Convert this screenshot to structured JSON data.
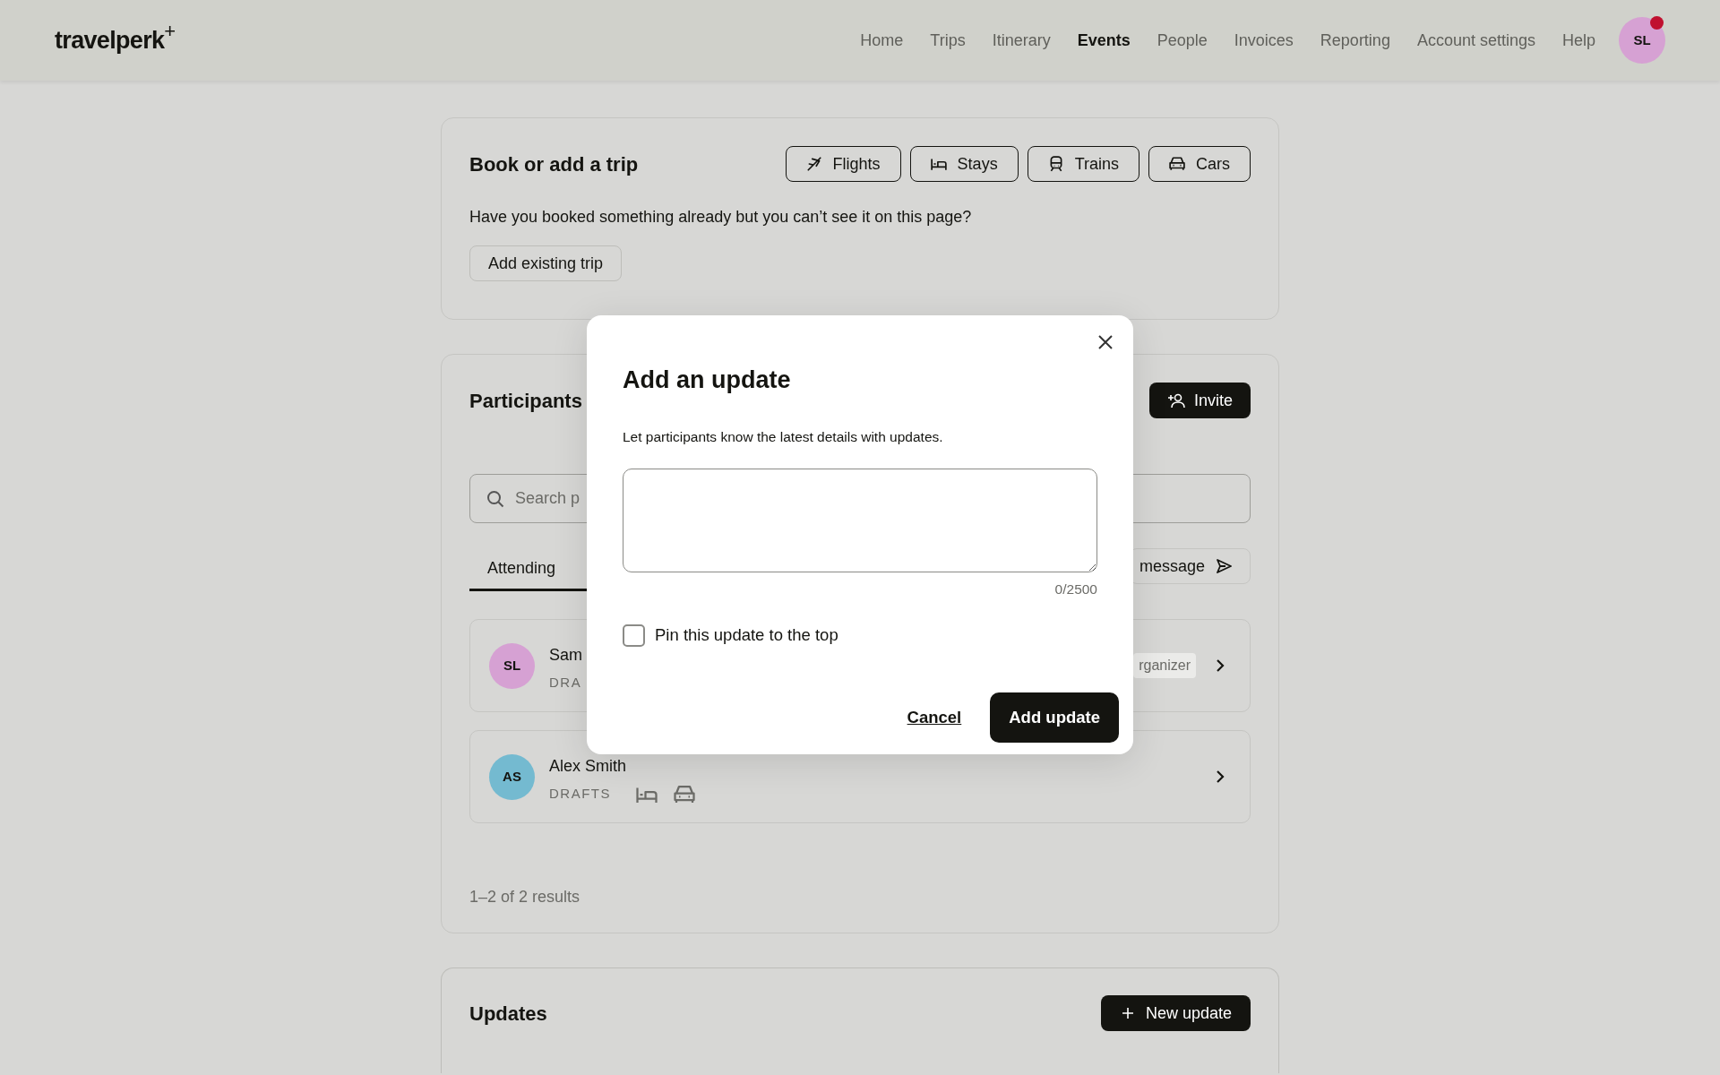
{
  "header": {
    "logo": "travelperk",
    "logo_mark": "+",
    "nav": [
      {
        "label": "Home",
        "selected": false
      },
      {
        "label": "Trips",
        "selected": false
      },
      {
        "label": "Itinerary",
        "selected": false
      },
      {
        "label": "Events",
        "selected": true
      },
      {
        "label": "People",
        "selected": false
      },
      {
        "label": "Invoices",
        "selected": false
      },
      {
        "label": "Reporting",
        "selected": false
      },
      {
        "label": "Account settings",
        "selected": false
      },
      {
        "label": "Help",
        "selected": false
      }
    ],
    "avatar": {
      "initials": "SL",
      "color": "#d6a1d3",
      "notification": true
    }
  },
  "book_trip": {
    "title": "Book or add a trip",
    "buttons": [
      {
        "label": "Flights",
        "kind": "flights"
      },
      {
        "label": "Stays",
        "kind": "stays"
      },
      {
        "label": "Trains",
        "kind": "trains"
      },
      {
        "label": "Cars",
        "kind": "cars"
      }
    ],
    "prompt": "Have you booked something already but you can’t see it on this page?",
    "add_button": "Add existing trip"
  },
  "participants": {
    "title": "Participants",
    "invite_button": "Invite",
    "search": {
      "placeholder": "Search p"
    },
    "tabs": [
      {
        "label": "Attending",
        "selected": true
      }
    ],
    "message_button": "message",
    "rows": [
      {
        "initials": "SL",
        "color": "#d6a1d3",
        "name": "Sam",
        "status": "DRA",
        "badge": "rganizer",
        "icons": []
      },
      {
        "initials": "AS",
        "color": "#74bad0",
        "name": "Alex Smith",
        "status": "DRAFTS",
        "icons": [
          {
            "kind": "stays"
          },
          {
            "kind": "cars"
          }
        ]
      }
    ],
    "results": "1–2 of 2 results"
  },
  "updates": {
    "title": "Updates",
    "button": "New update"
  },
  "modal": {
    "title": "Add an update",
    "description": "Let participants know the latest details with updates.",
    "counter": "0/2500",
    "checkbox": {
      "label": "Pin this update to the top",
      "checked": false
    },
    "cancel": "Cancel",
    "submit": "Add update"
  }
}
